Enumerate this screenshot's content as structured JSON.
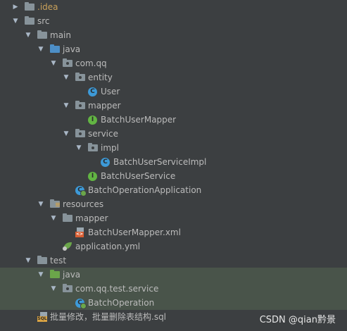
{
  "tree": {
    "idea": ".idea",
    "src": "src",
    "main": "main",
    "java": "java",
    "com_qq": "com.qq",
    "entity": "entity",
    "user": "User",
    "mapper": "mapper",
    "batch_user_mapper": "BatchUserMapper",
    "service": "service",
    "impl": "impl",
    "batch_user_service_impl": "BatchUserServiceImpl",
    "batch_user_service": "BatchUserService",
    "batch_operation_application": "BatchOperationApplication",
    "resources": "resources",
    "res_mapper": "mapper",
    "batch_user_mapper_xml": "BatchUserMapper.xml",
    "application_yml": "application.yml",
    "test": "test",
    "test_java": "java",
    "com_qq_test_service": "com.qq.test.service",
    "batch_operation": "BatchOperation",
    "sql_file": "批量修改，批量删除表结构.sql"
  },
  "icons": {
    "class": "C",
    "interface": "I",
    "xml_tag": "<>",
    "sql_tag": "SQL"
  },
  "watermark": "CSDN @qian黔景",
  "colors": {
    "background": "#3c3f41",
    "text": "#bbbbbb",
    "idea_text": "#c9a15a",
    "folder": "#87939a",
    "source_folder": "#4d8fc7",
    "test_folder": "#6ba64a",
    "class_badge": "#3d9ad8",
    "interface_badge": "#62b543"
  }
}
